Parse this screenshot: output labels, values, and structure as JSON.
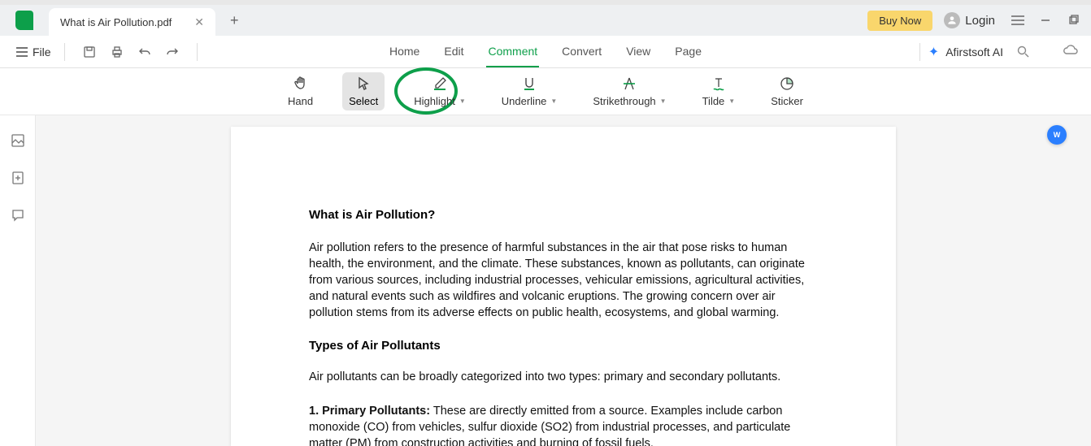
{
  "tab": {
    "title": "What is Air Pollution.pdf"
  },
  "titlebar": {
    "buy": "Buy Now",
    "login": "Login"
  },
  "menubar": {
    "file": "File",
    "tabs": [
      "Home",
      "Edit",
      "Comment",
      "Convert",
      "View",
      "Page"
    ],
    "active": 2,
    "ai": "Afirstsoft AI"
  },
  "toolbar": {
    "hand": "Hand",
    "select": "Select",
    "highlight": "Highlight",
    "underline": "Underline",
    "strike": "Strikethrough",
    "tilde": "Tilde",
    "sticker": "Sticker"
  },
  "document": {
    "heading1": "What is Air Pollution?",
    "para1": "Air pollution refers to the presence of harmful substances in the air that pose risks to human health, the environment, and the climate. These substances, known as pollutants, can originate from various sources, including industrial processes, vehicular emissions, agricultural activities, and natural events such as wildfires and volcanic eruptions. The growing concern over air pollution stems from its adverse effects on public health, ecosystems, and global warming.",
    "heading2": "Types of Air Pollutants",
    "para2": "Air pollutants can be broadly categorized into two types: primary and secondary pollutants.",
    "para3_bold": "1. Primary Pollutants:",
    "para3_rest": " These are directly emitted from a source. Examples include carbon monoxide (CO) from vehicles, sulfur dioxide (SO2) from industrial processes, and particulate matter (PM) from construction activities and burning of fossil fuels."
  }
}
